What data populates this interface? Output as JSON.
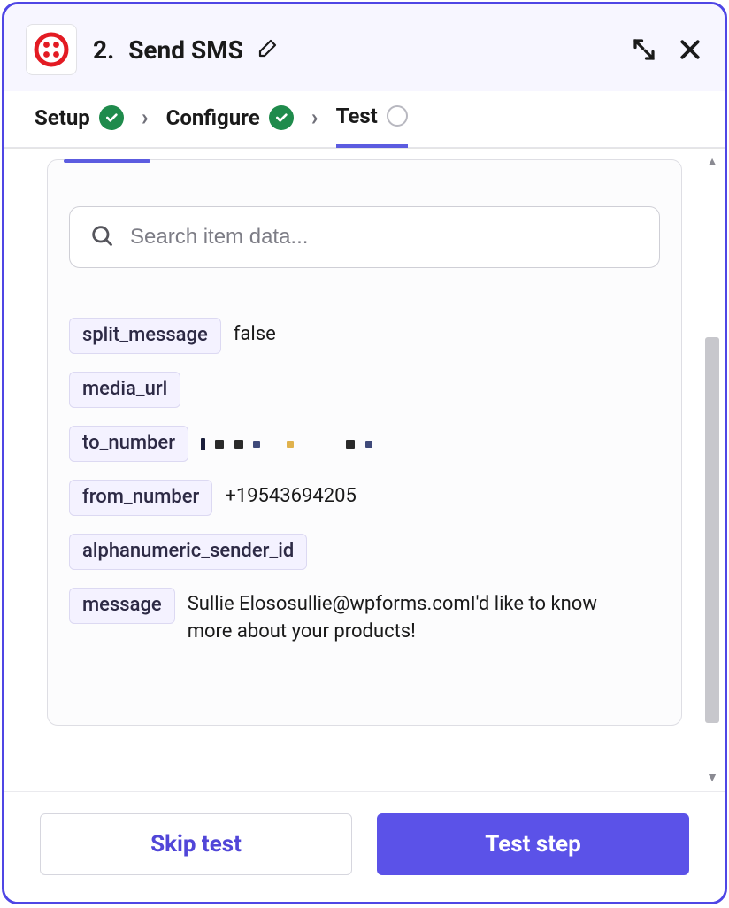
{
  "header": {
    "step_number": "2.",
    "title": "Send SMS"
  },
  "crumbs": {
    "setup": "Setup",
    "configure": "Configure",
    "test": "Test"
  },
  "search": {
    "placeholder": "Search item data..."
  },
  "fields": {
    "split_message": {
      "key": "split_message",
      "value": "false"
    },
    "media_url": {
      "key": "media_url",
      "value": ""
    },
    "to_number": {
      "key": "to_number",
      "value": "",
      "redacted": true
    },
    "from_number": {
      "key": "from_number",
      "value": "+19543694205"
    },
    "alphanumeric_sender_id": {
      "key": "alphanumeric_sender_id",
      "value": ""
    },
    "message": {
      "key": "message",
      "value": "Sullie Elososullie@wpforms.comI'd like to know more about your products!"
    }
  },
  "footer": {
    "skip": "Skip test",
    "test": "Test step"
  }
}
